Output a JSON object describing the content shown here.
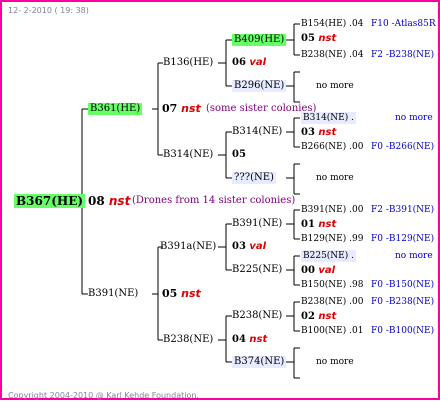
{
  "header": "12- 2-2010 ( 19: 38)",
  "footer": "Copyright 2004-2010 @ Karl Kehde Foundation.",
  "root": {
    "id": "B367(HE)",
    "gen": "08",
    "mark": " nst",
    "note": "(Drones from 14 sister colonies)"
  },
  "g1a": {
    "id": "B361(HE)",
    "gen": "07",
    "mark": " nst",
    "note": "(some sister colonies)"
  },
  "g1b": {
    "id": "B391(NE)",
    "gen": "05",
    "mark": " nst"
  },
  "g2a": {
    "id": "B136(HE)",
    "gen": "06",
    "mark": " val"
  },
  "g2b": {
    "id": "B314(NE)",
    "gen": "05"
  },
  "g2c": {
    "id": "B391a(NE)",
    "gen": "03",
    "mark": " val"
  },
  "g2d": {
    "id": "B238(NE)",
    "gen": "04",
    "mark": " nst"
  },
  "g3": [
    "B409(HE)",
    "B296(NE)",
    "B314(NE)",
    "???(NE)",
    "B391(NE)",
    "B225(NE)",
    "B238(NE)",
    "B374(NE)"
  ],
  "g4": [
    {
      "label": "B154(HE) .04",
      "link": "F10 -Atlas85R"
    },
    {
      "gen": "05",
      "mark": " nst"
    },
    {
      "label": "B238(NE) .04",
      "link": "F2 -B238(NE)"
    },
    {
      "more": "no more"
    },
    {
      "label": "B314(NE) .",
      "link": "no more",
      "shade": true
    },
    {
      "gen": "03",
      "mark": " nst"
    },
    {
      "label": "B266(NE) .00",
      "link": "F0 -B266(NE)"
    },
    {
      "more": "no more"
    },
    {
      "label": "B391(NE) .00",
      "link": "F2 -B391(NE)"
    },
    {
      "gen": "01",
      "mark": " nst"
    },
    {
      "label": "B129(NE) .99",
      "link": "F0 -B129(NE)"
    },
    {
      "label": "B225(NE) .",
      "link": "no more",
      "shade": true
    },
    {
      "gen": "00",
      "mark": " val"
    },
    {
      "label": "B150(NE) .98",
      "link": "F0 -B150(NE)"
    },
    {
      "label": "B238(NE) .00",
      "link": "F0 -B238(NE)"
    },
    {
      "gen": "02",
      "mark": " nst"
    },
    {
      "label": "B100(NE) .01",
      "link": "F0 -B100(NE)"
    },
    {
      "more": "no more"
    }
  ],
  "colors": {
    "border": "#ff00a0",
    "highlight": "#66ff66",
    "link": "#0000cc",
    "mark": "#dd0000"
  }
}
